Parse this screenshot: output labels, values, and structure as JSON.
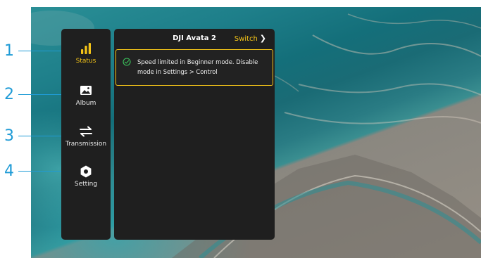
{
  "callouts": [
    {
      "num": "1"
    },
    {
      "num": "2"
    },
    {
      "num": "3"
    },
    {
      "num": "4"
    }
  ],
  "sidebar": {
    "items": [
      {
        "label": "Status",
        "icon": "bar-chart-icon",
        "active": true
      },
      {
        "label": "Album",
        "icon": "image-icon",
        "active": false
      },
      {
        "label": "Transmission",
        "icon": "swap-arrows-icon",
        "active": false
      },
      {
        "label": "Setting",
        "icon": "hex-gear-icon",
        "active": false
      }
    ]
  },
  "panel": {
    "title": "DJI Avata 2",
    "switch_label": "Switch",
    "switch_icon": "chevron-right-icon",
    "alert": {
      "icon": "check-circle-icon",
      "message": "Speed limited in Beginner mode. Disable mode in Settings > Control"
    }
  },
  "colors": {
    "accent": "#f5c518",
    "callout": "#1f9bd6",
    "panel_bg": "#1f1f1f"
  }
}
